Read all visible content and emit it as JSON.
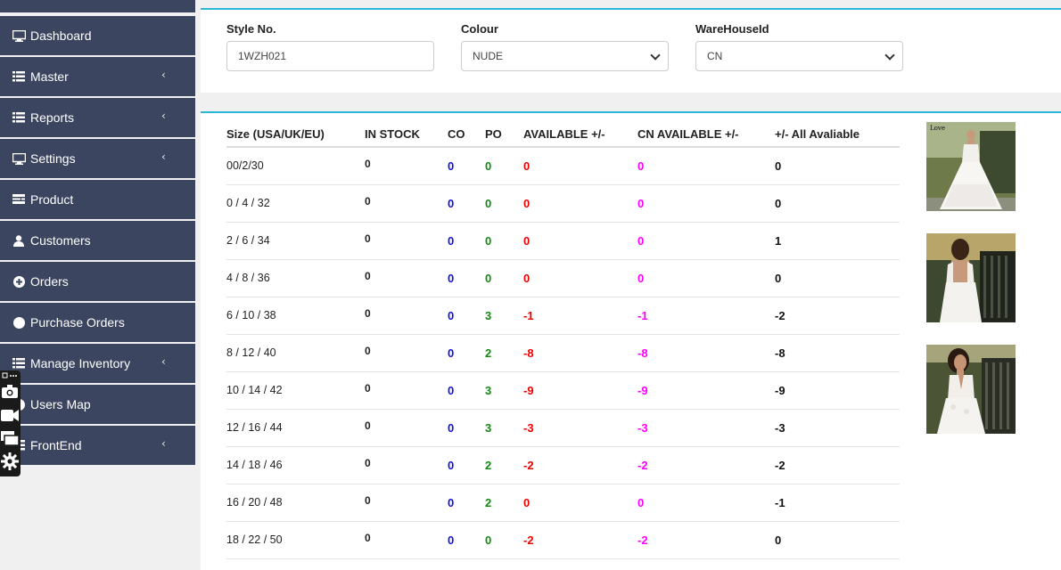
{
  "sidebar": {
    "items": [
      {
        "label": "Dashboard",
        "icon": "monitor-icon",
        "chevron": false
      },
      {
        "label": "Master",
        "icon": "list-icon",
        "chevron": true
      },
      {
        "label": "Reports",
        "icon": "list-icon",
        "chevron": true
      },
      {
        "label": "Settings",
        "icon": "monitor-icon",
        "chevron": true
      },
      {
        "label": "Product",
        "icon": "product-icon",
        "chevron": false
      },
      {
        "label": "Customers",
        "icon": "user-icon",
        "chevron": false
      },
      {
        "label": "Orders",
        "icon": "plus-circle-icon",
        "chevron": false
      },
      {
        "label": "Purchase Orders",
        "icon": "circle-icon",
        "chevron": false
      },
      {
        "label": "Manage Inventory",
        "icon": "list-icon",
        "chevron": true
      },
      {
        "label": "Users Map",
        "icon": "map-icon",
        "chevron": false
      },
      {
        "label": "FrontEnd",
        "icon": "list-icon",
        "chevron": true
      }
    ],
    "chevron_glyph": "‹"
  },
  "filters": {
    "style_label": "Style No.",
    "style_value": "1WZH021",
    "colour_label": "Colour",
    "colour_value": "NUDE",
    "warehouse_label": "WareHouseId",
    "warehouse_value": "CN"
  },
  "table": {
    "headers": [
      "Size (USA/UK/EU)",
      "IN STOCK",
      "CO",
      "PO",
      "AVAILABLE +/-",
      "CN AVAILABLE +/-",
      "+/- All Avaliable"
    ],
    "rows": [
      {
        "size": "00/2/30",
        "stock": "0",
        "co": "0",
        "po": "0",
        "avail": "0",
        "cn": "0",
        "all": "0"
      },
      {
        "size": "0 / 4 / 32",
        "stock": "0",
        "co": "0",
        "po": "0",
        "avail": "0",
        "cn": "0",
        "all": "0"
      },
      {
        "size": "2 / 6 / 34",
        "stock": "0",
        "co": "0",
        "po": "0",
        "avail": "0",
        "cn": "0",
        "all": "1"
      },
      {
        "size": "4 / 8 / 36",
        "stock": "0",
        "co": "0",
        "po": "0",
        "avail": "0",
        "cn": "0",
        "all": "0"
      },
      {
        "size": "6 / 10 / 38",
        "stock": "0",
        "co": "0",
        "po": "3",
        "avail": "-1",
        "cn": "-1",
        "all": "-2"
      },
      {
        "size": "8 / 12 / 40",
        "stock": "0",
        "co": "0",
        "po": "2",
        "avail": "-8",
        "cn": "-8",
        "all": "-8"
      },
      {
        "size": "10 / 14 / 42",
        "stock": "0",
        "co": "0",
        "po": "3",
        "avail": "-9",
        "cn": "-9",
        "all": "-9"
      },
      {
        "size": "12 / 16 / 44",
        "stock": "0",
        "co": "0",
        "po": "3",
        "avail": "-3",
        "cn": "-3",
        "all": "-3"
      },
      {
        "size": "14 / 18 / 46",
        "stock": "0",
        "co": "0",
        "po": "2",
        "avail": "-2",
        "cn": "-2",
        "all": "-2"
      },
      {
        "size": "16 / 20 / 48",
        "stock": "0",
        "co": "0",
        "po": "2",
        "avail": "0",
        "cn": "0",
        "all": "-1"
      },
      {
        "size": "18 / 22 / 50",
        "stock": "0",
        "co": "0",
        "po": "0",
        "avail": "-2",
        "cn": "-2",
        "all": "0"
      }
    ]
  },
  "colors": {
    "sidebar_bg": "#3b4560",
    "accent": "#2bb8d6",
    "co": "#1010d0",
    "po": "#118a11",
    "available": "#e00000",
    "cn_available": "#ff00ff"
  },
  "floating_toolbar": [
    "layers-icon",
    "camera-icon",
    "video-icon",
    "chat-icon",
    "gear-icon"
  ]
}
